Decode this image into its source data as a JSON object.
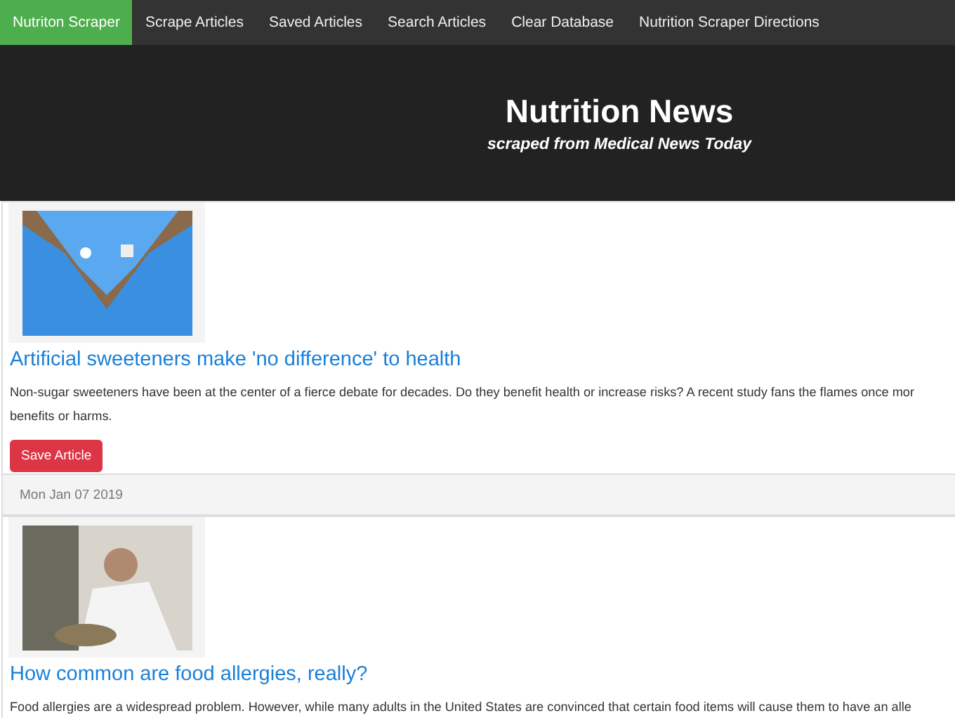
{
  "nav": {
    "brand": "Nutriton Scraper",
    "items": [
      "Scrape Articles",
      "Saved Articles",
      "Search Articles",
      "Clear Database",
      "Nutrition Scraper Directions"
    ]
  },
  "header": {
    "title": "Nutrition News",
    "subtitle": "scraped from Medical News Today"
  },
  "articles": [
    {
      "kind": "gloves",
      "title": "Artificial sweeteners make 'no difference' to health",
      "summary_lines": [
        "Non-sugar sweeteners have been at the center of a fierce debate for decades. Do they benefit health or increase risks? A recent study fans the flames once mor",
        "benefits or harms."
      ],
      "button": "Save Article",
      "date": "Mon Jan 07 2019"
    },
    {
      "kind": "diner",
      "title": "How common are food allergies, really?",
      "summary_lines": [
        "Food allergies are a widespread problem. However, while many adults in the United States are convinced that certain food items will cause them to have an alle"
      ]
    }
  ]
}
